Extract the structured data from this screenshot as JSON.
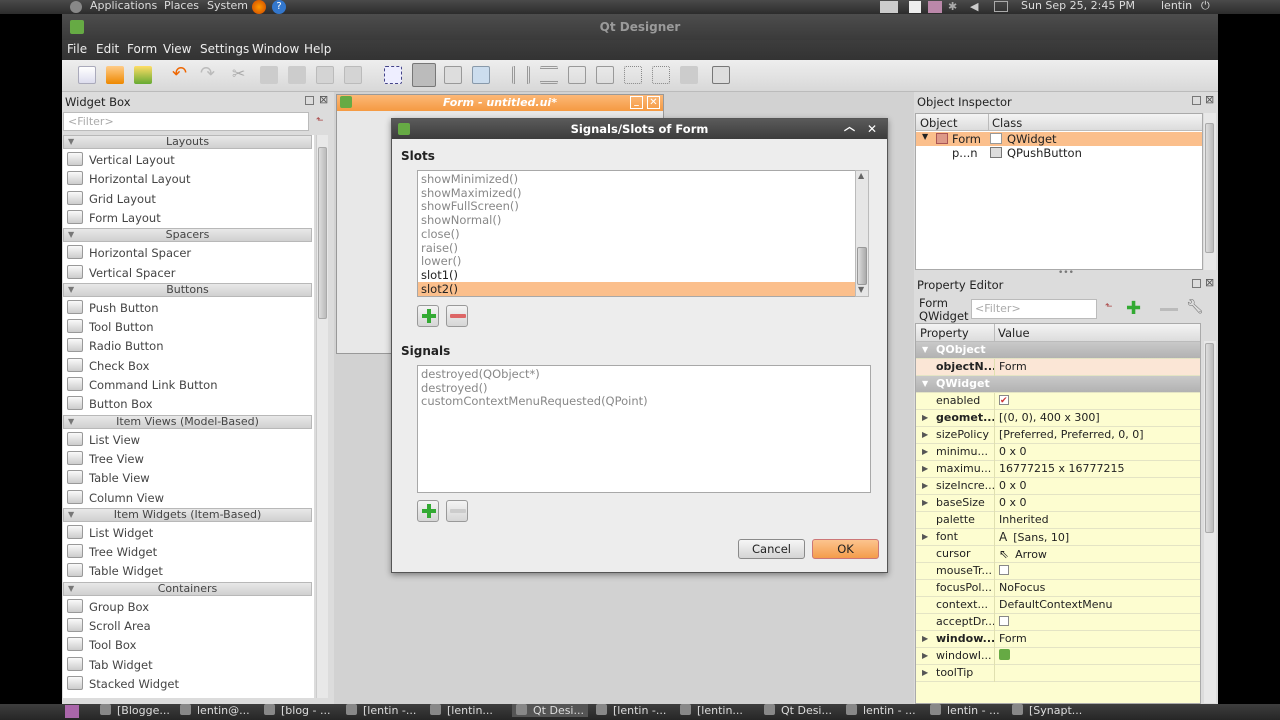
{
  "top_panel": {
    "applications": "Applications",
    "places": "Places",
    "system": "System",
    "datetime": "Sun Sep 25,  2:45 PM",
    "user": "lentin"
  },
  "window": {
    "title": "Qt Designer",
    "menu": [
      "File",
      "Edit",
      "Form",
      "View",
      "Settings",
      "Window",
      "Help"
    ]
  },
  "widget_box": {
    "title": "Widget Box",
    "filter_placeholder": "<Filter>",
    "categories": [
      {
        "label": "Layouts",
        "items": [
          "Vertical Layout",
          "Horizontal Layout",
          "Grid Layout",
          "Form Layout"
        ]
      },
      {
        "label": "Spacers",
        "items": [
          "Horizontal Spacer",
          "Vertical Spacer"
        ]
      },
      {
        "label": "Buttons",
        "items": [
          "Push Button",
          "Tool Button",
          "Radio Button",
          "Check Box",
          "Command Link Button",
          "Button Box"
        ]
      },
      {
        "label": "Item Views (Model-Based)",
        "items": [
          "List View",
          "Tree View",
          "Table View",
          "Column View"
        ]
      },
      {
        "label": "Item Widgets (Item-Based)",
        "items": [
          "List Widget",
          "Tree Widget",
          "Table Widget"
        ]
      },
      {
        "label": "Containers",
        "items": [
          "Group Box",
          "Scroll Area",
          "Tool Box",
          "Tab Widget",
          "Stacked Widget"
        ]
      }
    ]
  },
  "form_window": {
    "title": "Form - untitled.ui*"
  },
  "dialog": {
    "title": "Signals/Slots of Form",
    "slots_label": "Slots",
    "slots": [
      "showMinimized()",
      "showMaximized()",
      "showFullScreen()",
      "showNormal()",
      "close()",
      "raise()",
      "lower()",
      "slot1()",
      "slot2()"
    ],
    "signals_label": "Signals",
    "signals": [
      "destroyed(QObject*)",
      "destroyed()",
      "customContextMenuRequested(QPoint)"
    ],
    "cancel": "Cancel",
    "ok": "OK"
  },
  "object_inspector": {
    "title": "Object Inspector",
    "col_object": "Object",
    "col_class": "Class",
    "rows": [
      {
        "object": "Form",
        "class": "QWidget"
      },
      {
        "object": "p...n",
        "class": "QPushButton"
      }
    ]
  },
  "property_editor": {
    "title": "Property Editor",
    "object_label": "Form",
    "class_label": "QWidget",
    "filter_placeholder": "<Filter>",
    "col_property": "Property",
    "col_value": "Value",
    "rows": [
      {
        "group": "QObject"
      },
      {
        "name": "objectN...",
        "value": "Form",
        "bold": true
      },
      {
        "group": "QWidget"
      },
      {
        "name": "enabled",
        "value": "",
        "check": "checked"
      },
      {
        "name": "geomet...",
        "value": "[(0, 0), 400 x 300]",
        "bold": true,
        "exp": true
      },
      {
        "name": "sizePolicy",
        "value": "[Preferred, Preferred, 0, 0]",
        "exp": true
      },
      {
        "name": "minimu...",
        "value": "0 x 0",
        "exp": true
      },
      {
        "name": "maximu...",
        "value": "16777215 x 16777215",
        "exp": true
      },
      {
        "name": "sizeIncre...",
        "value": "0 x 0",
        "exp": true
      },
      {
        "name": "baseSize",
        "value": "0 x 0",
        "exp": true
      },
      {
        "name": "palette",
        "value": "Inherited"
      },
      {
        "name": "font",
        "value": "[Sans, 10]",
        "exp": true,
        "prefix": "A"
      },
      {
        "name": "cursor",
        "value": "Arrow",
        "prefix": "⇖"
      },
      {
        "name": "mouseTr...",
        "value": "",
        "check": "unchecked"
      },
      {
        "name": "focusPol...",
        "value": "NoFocus"
      },
      {
        "name": "context...",
        "value": "DefaultContextMenu"
      },
      {
        "name": "acceptDr...",
        "value": "",
        "check": "unchecked"
      },
      {
        "name": "window...",
        "value": "Form",
        "bold": true,
        "exp": true
      },
      {
        "name": "windowI...",
        "value": "",
        "exp": true,
        "icon": true
      },
      {
        "name": "toolTip",
        "value": "",
        "exp": true
      }
    ]
  },
  "taskbar": [
    "[Blogge...",
    "lentin@...",
    "[blog - ...",
    "[lentin -...",
    "[lentin...",
    "Qt Desi...",
    "[lentin -...",
    "[lentin...",
    "Qt Desi...",
    "lentin - ...",
    "lentin - ...",
    "[Synapt..."
  ],
  "colors": {
    "accent": "#f7a85f",
    "selection": "#fbbf8c",
    "prop_bg": "#fdfdd0"
  }
}
